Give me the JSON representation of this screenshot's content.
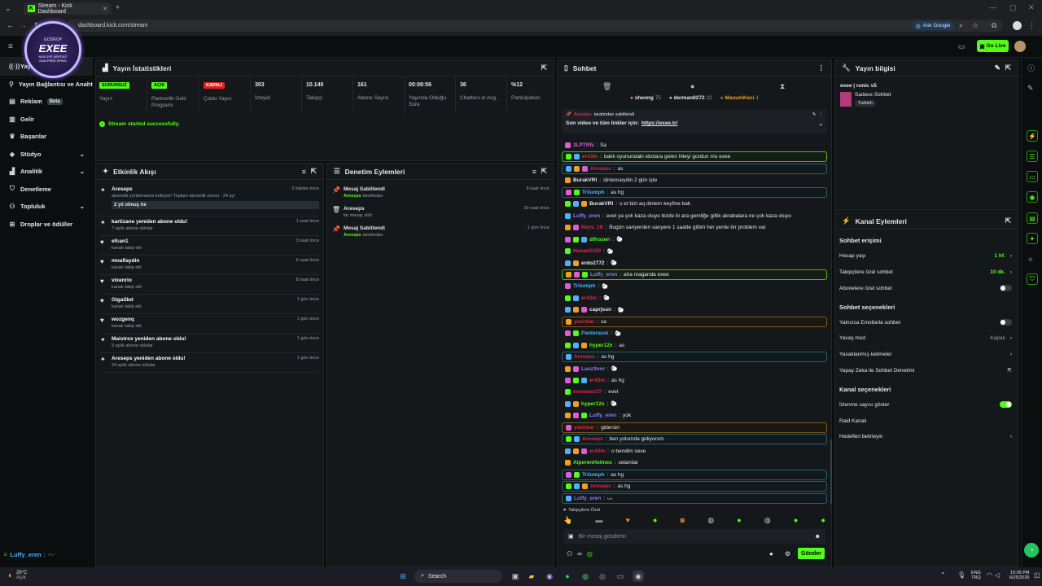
{
  "browser": {
    "tab_title": "Stream - Kick Dashboard",
    "url": "dashboard.kick.com/stream",
    "ask_google": "Ask Google"
  },
  "topbar": {
    "go_live": "Go Live"
  },
  "sidebar": {
    "items": [
      {
        "label": "Yayın",
        "icon": "broadcast-icon"
      },
      {
        "label": "Yayın Bağlantısı ve Anahtarı",
        "icon": "link-icon"
      },
      {
        "label": "Reklam",
        "icon": "ad-icon",
        "badge": "Beta"
      },
      {
        "label": "Gelir",
        "icon": "wallet-icon"
      },
      {
        "label": "Başarılar",
        "icon": "trophy-icon"
      },
      {
        "label": "Stüdyo",
        "icon": "studio-icon",
        "chevron": true
      },
      {
        "label": "Analitik",
        "icon": "chart-icon",
        "chevron": true
      },
      {
        "label": "Denetleme",
        "icon": "shield-icon"
      },
      {
        "label": "Topluluk",
        "icon": "users-icon",
        "chevron": true
      },
      {
        "label": "Droplar ve ödüller",
        "icon": "gift-icon"
      }
    ],
    "footer_user": "Luffy_eren",
    "footer_suffix": ":"
  },
  "overlay": {
    "title": "EXEE",
    "sub1": "GODROP",
    "sub2": "%25 ÜYE DEPOSIT",
    "sub3": "DAN FREE SPINS"
  },
  "stats": {
    "title": "Yayın İstatistikleri",
    "items": [
      {
        "value": "SORUNSUZ",
        "label": "Yayın",
        "badge": "green"
      },
      {
        "value": "AÇIK",
        "label": "Partnerlik Gelir Programı",
        "badge": "green"
      },
      {
        "value": "KAPALI",
        "label": "Çoklu Yayın",
        "badge": "red"
      },
      {
        "value": "303",
        "label": "İzleyici"
      },
      {
        "value": "10.140",
        "label": "Takipçi"
      },
      {
        "value": "161",
        "label": "Abone Sayısı"
      },
      {
        "value": "00:08:56",
        "label": "Yayında Olduğu Süre"
      },
      {
        "value": "36",
        "label": "Chatters in Avg."
      },
      {
        "value": "%12",
        "label": "Participation"
      }
    ],
    "status": "Stream started successfully."
  },
  "activity": {
    "title": "Etkinlik Akışı",
    "items": [
      {
        "title": "Areseps",
        "sub": "abonelik yenilemesini kutluyor! Toplam abonelik süresi - 24 ay!",
        "time": "3 dakika önce",
        "msg": "2 yıl olmuş he",
        "icon": "sparkle-icon"
      },
      {
        "title": "kartizane yeniden abone oldu!",
        "sub": "7 aylık abone oldular",
        "time": "1 saat önce",
        "icon": "sparkle-icon"
      },
      {
        "title": "efcan1",
        "sub": "kanalı takip etti",
        "time": "3 saat önce",
        "icon": "heart-icon"
      },
      {
        "title": "mnafiaydin",
        "sub": "kanalı takip etti",
        "time": "6 saat önce",
        "icon": "heart-icon"
      },
      {
        "title": "vixenrio",
        "sub": "kanalı takip etti",
        "time": "8 saat önce",
        "icon": "heart-icon"
      },
      {
        "title": "GigaSbd",
        "sub": "kanalı takip etti",
        "time": "1 gün önce",
        "icon": "heart-icon"
      },
      {
        "title": "wozgenq",
        "sub": "kanalı takip etti",
        "time": "1 gün önce",
        "icon": "heart-icon"
      },
      {
        "title": "Maistrox yeniden abone oldu!",
        "sub": "5 aylık abone oldular",
        "time": "1 gün önce",
        "icon": "sparkle-icon"
      },
      {
        "title": "Areseps yeniden abone oldu!",
        "sub": "24 aylık abone oldular",
        "time": "1 gün önce",
        "icon": "sparkle-icon"
      }
    ]
  },
  "moderation": {
    "title": "Denetim Eylemleri",
    "items": [
      {
        "title": "Mesaj Sabitlendi",
        "user": "Areseps",
        "suffix": "tarafından",
        "time": "8 saat önce",
        "icon": "pin-icon"
      },
      {
        "title": "Areseps",
        "user": "",
        "suffix": "bir mesajı sildi",
        "time": "10 saat önce",
        "icon": "trash-icon"
      },
      {
        "title": "Mesaj Sabitlendi",
        "user": "Areseps",
        "suffix": "tarafından",
        "time": "1 gün önce",
        "icon": "pin-icon"
      }
    ]
  },
  "chat": {
    "title": "Sohbet",
    "top_gifters": [
      {
        "name": "shenng",
        "count": "75"
      },
      {
        "name": "derman8272",
        "count": "22"
      },
      {
        "name": "MasumKeci",
        "count": "1"
      }
    ],
    "pinned": {
      "by": "Areseps",
      "by_suffix": "tarafından sabitlendi",
      "text": "Son video ve tüm linkler için:",
      "link": "https://exee.tr/"
    },
    "messages": [
      {
        "user": "3LPTRN",
        "color": "#e05bd6",
        "text": "Sa"
      },
      {
        "user": "er43m",
        "color": "#e0264a",
        "text": "balık oyunundaki ebolara gelen hileyi gordun mu exee",
        "hl": "hl"
      },
      {
        "user": "Areseps",
        "color": "#e0264a",
        "text": "as",
        "hl": "hlb"
      },
      {
        "user": "BurakVRI",
        "color": "#e6e8ea",
        "text": "dinlenseydin 2 gün işte"
      },
      {
        "user": "Triiumph",
        "color": "#4fb0ff",
        "text": "as hg",
        "hl": "hlb"
      },
      {
        "user": "BurakVRI",
        "color": "#e6e8ea",
        "text": "s et bizi aq dinlern keyfine bak"
      },
      {
        "user": "Luffy_eren",
        "color": "#8a7cff",
        "text": "evet ya çok kaza oluyo bizde bi ara gemliğe giltik akrabalara ne çok kaza oluyo"
      },
      {
        "user": "Neys_18",
        "color": "#e0264a",
        "text": "Bugün sanyerden sanyere 1 saatte gittim her yerde bir problem var"
      },
      {
        "user": "dlfrozen",
        "color": "#53fc18",
        "text": "🐑"
      },
      {
        "user": "Hasan3150",
        "color": "#e0264a",
        "text": "🐑"
      },
      {
        "user": "erdo2772",
        "color": "#e6e8ea",
        "text": "🐑"
      },
      {
        "user": "Luffy_eren",
        "color": "#8a7cff",
        "text": "aha maganda exee",
        "hl": "hl"
      },
      {
        "user": "Triiumph",
        "color": "#4fb0ff",
        "text": "🐑"
      },
      {
        "user": "er43m",
        "color": "#e0264a",
        "text": "🐑"
      },
      {
        "user": "caprjsun",
        "color": "#e6e8ea",
        "text": "🐑"
      },
      {
        "user": "yasirbar",
        "color": "#e0264a",
        "text": "sa",
        "hl": "hlo"
      },
      {
        "user": "Panterausi",
        "color": "#4fb0ff",
        "text": "🐑"
      },
      {
        "user": "hyper12x",
        "color": "#53fc18",
        "text": "as"
      },
      {
        "user": "Areseps",
        "color": "#e0264a",
        "text": "as hg",
        "hl": "hlb"
      },
      {
        "user": "Lauz3nnr",
        "color": "#8a7cff",
        "text": "🐑"
      },
      {
        "user": "er43m",
        "color": "#e0264a",
        "text": "as hg"
      },
      {
        "user": "numanez37",
        "color": "#e0264a",
        "text": "evet"
      },
      {
        "user": "hyper12x",
        "color": "#53fc18",
        "text": "🐑"
      },
      {
        "user": "Luffy_eren",
        "color": "#8a7cff",
        "text": "yok"
      },
      {
        "user": "yasirbar",
        "color": "#e0264a",
        "text": "gidersin",
        "hl": "hlo"
      },
      {
        "user": "Areseps",
        "color": "#e0264a",
        "text": "ben yolumda gidiyorum",
        "hl": "hlb"
      },
      {
        "user": "er43m",
        "color": "#e0264a",
        "text": "o bendim sexe"
      },
      {
        "user": "AlperenHolmes",
        "color": "#53fc18",
        "text": "selamlar"
      },
      {
        "user": "Triiumph",
        "color": "#4fb0ff",
        "text": "as hg",
        "hl": "hlb"
      },
      {
        "user": "Areseps",
        "color": "#e0264a",
        "text": "as hg",
        "hl": "hlb"
      },
      {
        "user": "Luffy_eren",
        "color": "#8a7cff",
        "text": "〰",
        "hl": "hlb"
      }
    ],
    "followers_only": "Takipçilere Özel",
    "input_placeholder": "Bir mesaj gönderin",
    "send": "Gönder"
  },
  "stream_info": {
    "title": "Yayın bilgisi",
    "stream_title": "exee | runic v5",
    "category": "Sadece Sohbet",
    "tag": "Turkish"
  },
  "channel": {
    "title": "Kanal Eylemleri",
    "chat_access": "Sohbet erişimi",
    "account_age": {
      "label": "Hesap yaşı",
      "value": "1 hf."
    },
    "followers_only": {
      "label": "Takipçilere özel sohbet",
      "value": "10 dk."
    },
    "subs_only": {
      "label": "Abonelere özel sohbet"
    },
    "chat_options": "Sohbet seçenekleri",
    "emote_only": {
      "label": "Yalnızca Emotlarla sohbet"
    },
    "slow": {
      "label": "Yavaş mod",
      "value": "Kapalı"
    },
    "banned": {
      "label": "Yasaklanmış kelimeler"
    },
    "ai": {
      "label": "Yapay Zeka ile Sohbet Denetimi"
    },
    "channel_options": "Kanal seçenekleri",
    "viewer_count": {
      "label": "İzlenme sayısı göster"
    },
    "raid": {
      "label": "Raid Kanalı"
    },
    "goals": {
      "label": "Hedefleri belirleyin"
    }
  },
  "taskbar": {
    "weather_temp": "26°C",
    "weather_desc": "Açık",
    "search": "Search",
    "lang1": "ENG",
    "lang2": "TRQ",
    "time": "10:05 PM",
    "date": "6/25/2026"
  }
}
